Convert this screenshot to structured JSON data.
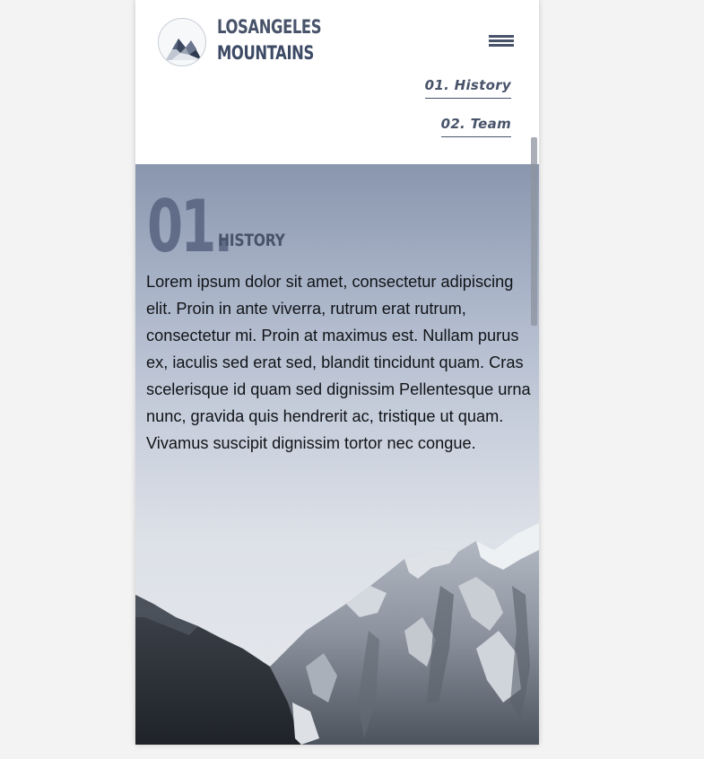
{
  "brand": {
    "line1": "LOSANGELES",
    "line2": "MOUNTAINS",
    "logo_icon": "mountain-logo-icon"
  },
  "menu": {
    "icon": "hamburger-menu-icon"
  },
  "nav": {
    "items": [
      {
        "label": "01. History"
      },
      {
        "label": "02. Team"
      }
    ]
  },
  "section": {
    "number": "01.",
    "title": "HISTORY",
    "body": "Lorem ipsum dolor sit amet, consectetur adipiscing elit. Proin in ante viverra, rutrum erat rutrum, consectetur mi. Proin at maximus est. Nullam purus ex, iaculis sed erat sed, blandit tincidunt quam. Cras scelerisque id quam sed dignissim Pellentesque urna nunc, gravida quis hendrerit ac, tristique ut quam. Vivamus suscipit dignissim tortor nec congue."
  },
  "colors": {
    "accent": "#48536a",
    "page_background": "#f3f3f3",
    "text": "#111418"
  }
}
